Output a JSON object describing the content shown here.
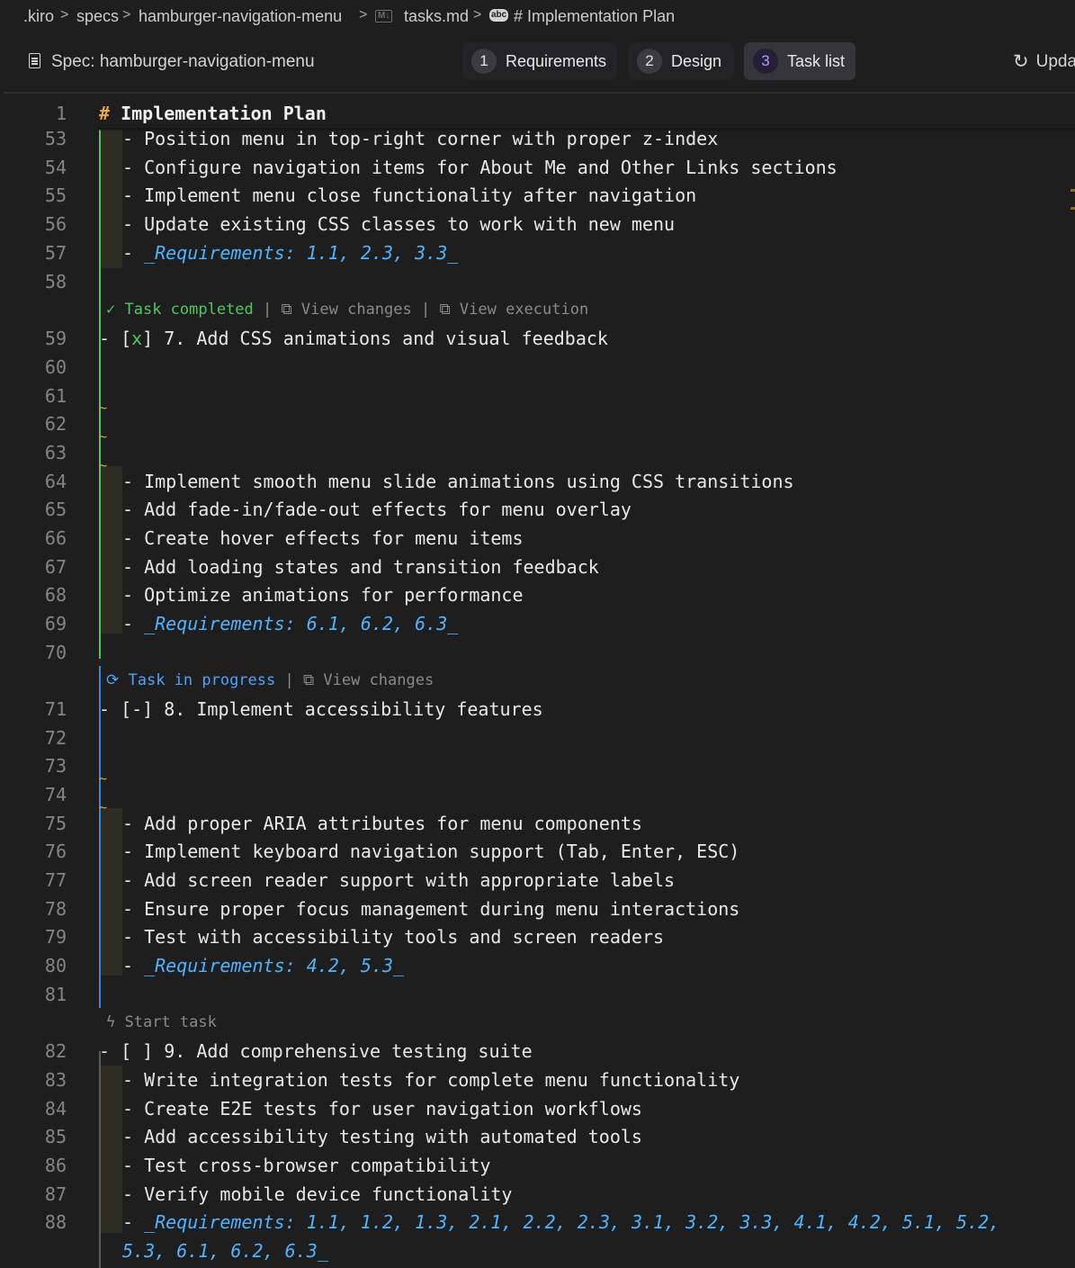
{
  "breadcrumb": {
    "items": [
      ".kiro",
      "specs",
      "hamburger-navigation-menu",
      "tasks.md",
      "# Implementation Plan"
    ],
    "md_icon": "M↓",
    "abc_icon": "abc",
    "sep": ">"
  },
  "toolbar": {
    "spec_title": "Spec: hamburger-navigation-menu",
    "steps": [
      {
        "num": "1",
        "label": "Requirements"
      },
      {
        "num": "2",
        "label": "Design"
      },
      {
        "num": "3",
        "label": "Task list"
      }
    ],
    "update_label": "Upda"
  },
  "editor": {
    "heading": {
      "num": "1",
      "hash": "#",
      "text": " Implementation Plan"
    },
    "lines": {
      "l53": {
        "num": "53",
        "text": "- Position menu in top-right corner with proper z-index"
      },
      "l54": {
        "num": "54",
        "text": "- Configure navigation items for About Me and Other Links sections"
      },
      "l55": {
        "num": "55",
        "text": "- Implement menu close functionality after navigation"
      },
      "l56": {
        "num": "56",
        "text": "- Update existing CSS classes to work with new menu"
      },
      "l57": {
        "num": "57",
        "prefix": "- ",
        "req": "_Requirements: 1.1, 2.3, 3.3_"
      },
      "l58": {
        "num": "58"
      },
      "l59": {
        "num": "59",
        "pre": "- [",
        "mark": "x",
        "post": "] 7. Add CSS animations and visual feedback"
      },
      "l60": {
        "num": "60"
      },
      "l61": {
        "num": "61"
      },
      "l62": {
        "num": "62"
      },
      "l63": {
        "num": "63"
      },
      "l64": {
        "num": "64",
        "text": "- Implement smooth menu slide animations using CSS transitions"
      },
      "l65": {
        "num": "65",
        "text": "- Add fade-in/fade-out effects for menu overlay"
      },
      "l66": {
        "num": "66",
        "text": "- Create hover effects for menu items"
      },
      "l67": {
        "num": "67",
        "text": "- Add loading states and transition feedback"
      },
      "l68": {
        "num": "68",
        "text": "- Optimize animations for performance"
      },
      "l69": {
        "num": "69",
        "prefix": "- ",
        "req": "_Requirements: 6.1, 6.2, 6.3_"
      },
      "l70": {
        "num": "70"
      },
      "l71": {
        "num": "71",
        "text": "- [-] 8. Implement accessibility features"
      },
      "l72": {
        "num": "72"
      },
      "l73": {
        "num": "73"
      },
      "l74": {
        "num": "74"
      },
      "l75": {
        "num": "75",
        "text": "- Add proper ARIA attributes for menu components"
      },
      "l76": {
        "num": "76",
        "text": "- Implement keyboard navigation support (Tab, Enter, ESC)"
      },
      "l77": {
        "num": "77",
        "text": "- Add screen reader support with appropriate labels"
      },
      "l78": {
        "num": "78",
        "text": "- Ensure proper focus management during menu interactions"
      },
      "l79": {
        "num": "79",
        "text": "- Test with accessibility tools and screen readers"
      },
      "l80": {
        "num": "80",
        "prefix": "- ",
        "req": "_Requirements: 4.2, 5.3_"
      },
      "l81": {
        "num": "81"
      },
      "l82": {
        "num": "82",
        "text": "- [ ] 9. Add comprehensive testing suite"
      },
      "l83": {
        "num": "83",
        "text": "- Write integration tests for complete menu functionality"
      },
      "l84": {
        "num": "84",
        "text": "- Create E2E tests for user navigation workflows"
      },
      "l85": {
        "num": "85",
        "text": "- Add accessibility testing with automated tools"
      },
      "l86": {
        "num": "86",
        "text": "- Test cross-browser compatibility"
      },
      "l87": {
        "num": "87",
        "text": "- Verify mobile device functionality"
      },
      "l88": {
        "num": "88",
        "prefix": "- ",
        "req": "_Requirements: 1.1, 1.2, 1.3, 2.1, 2.2, 2.3, 3.1, 3.2, 3.3, 4.1, 4.2, 5.1, 5.2,",
        "req_wrap": "5.3, 6.1, 6.2, 6.3_"
      }
    },
    "codelens": {
      "task7": {
        "status": "Task completed",
        "sep": "|",
        "view_changes": "View changes",
        "view_execution": "View execution"
      },
      "task8": {
        "status": "Task in progress",
        "sep": "|",
        "view_changes": "View changes"
      },
      "task9": {
        "start": "Start task"
      }
    },
    "tilde": "~",
    "colors": {
      "completed": "#4ec960",
      "in_progress": "#4aa3ff",
      "requirements": "#4fb3ff",
      "heading_hash": "#e5a44d"
    }
  }
}
